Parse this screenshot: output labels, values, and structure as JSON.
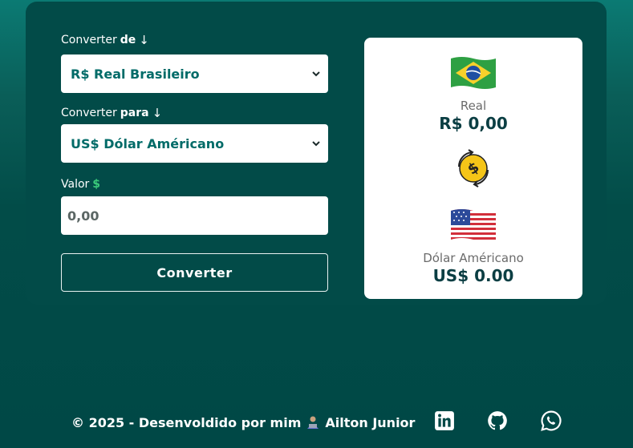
{
  "form": {
    "from_label_prefix": "Converter",
    "from_label_strong": "de",
    "from_label_arrow": "↓",
    "from_selected": "R$ Real Brasileiro",
    "to_label_prefix": "Converter",
    "to_label_strong": "para",
    "to_label_arrow": "↓",
    "to_selected": "US$ Dólar Américano",
    "value_label": "Valor",
    "value_symbol": "$",
    "value_placeholder": "0,00",
    "convert_button": "Converter"
  },
  "result": {
    "from_currency_name": "Real",
    "from_currency_value": "R$ 0,00",
    "to_currency_name": "Dólar Américano",
    "to_currency_value": "US$ 0.00",
    "from_flag_icon": "brazil-flag-icon",
    "exchange_icon": "currency-exchange-icon",
    "to_flag_icon": "usa-flag-icon"
  },
  "footer": {
    "copyright": "© 2025 - Desenvoldido por mim",
    "author": "Ailton Junior",
    "social": [
      "linkedin-icon",
      "github-icon",
      "whatsapp-icon"
    ]
  },
  "colors": {
    "background": "#004846",
    "card": "#024b48",
    "accent_text": "#006b68",
    "dollar_green": "#3ac97a"
  }
}
